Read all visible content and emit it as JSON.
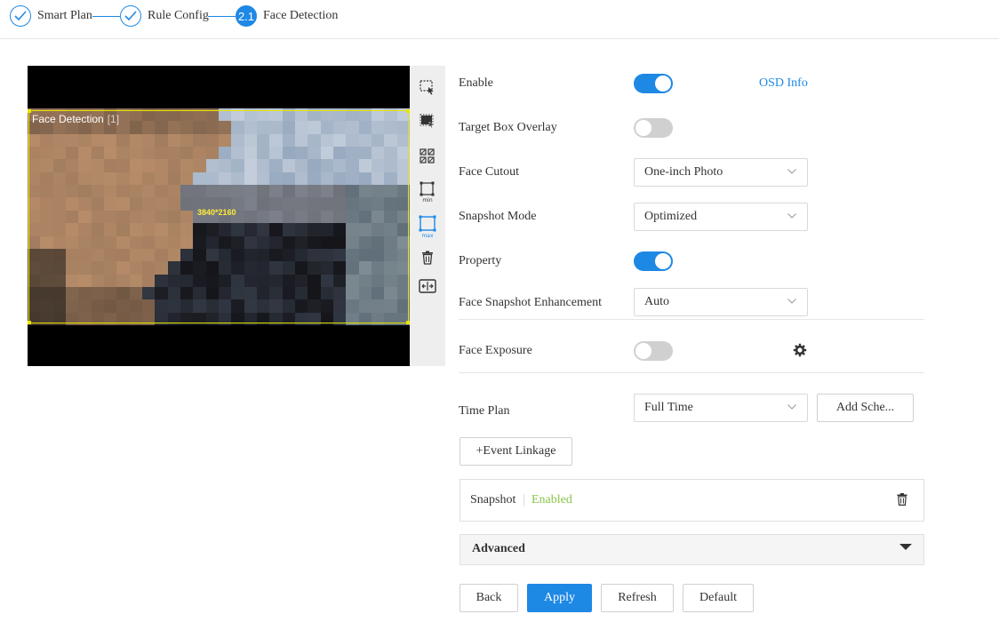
{
  "stepper": {
    "steps": [
      {
        "label": "Smart Plan",
        "state": "done"
      },
      {
        "label": "Rule Config",
        "state": "done"
      },
      {
        "label": "Face Detection",
        "state": "active",
        "number": "2.1"
      }
    ]
  },
  "video": {
    "roi_label": "Face Detection",
    "roi_label_suffix": "[1]",
    "resolution": "3840*2160"
  },
  "toolbar": {
    "tools": [
      "select-region-icon",
      "draw-region-icon",
      "grid-icon",
      "min-size-icon",
      "max-size-icon",
      "delete-icon",
      "expand-icon"
    ],
    "min_text": "min",
    "max_text": "max"
  },
  "form": {
    "enable": {
      "label": "Enable",
      "value": true
    },
    "osd_info": "OSD Info",
    "target_box_overlay": {
      "label": "Target Box Overlay",
      "value": false
    },
    "face_cutout": {
      "label": "Face Cutout",
      "value": "One-inch Photo"
    },
    "snapshot_mode": {
      "label": "Snapshot Mode",
      "value": "Optimized"
    },
    "property": {
      "label": "Property",
      "value": true
    },
    "face_snapshot_enhancement": {
      "label": "Face Snapshot Enhancement",
      "value": "Auto"
    },
    "face_exposure": {
      "label": "Face Exposure",
      "value": false
    },
    "time_plan": {
      "label": "Time Plan",
      "value": "Full Time",
      "add_schedule": "Add Sche..."
    },
    "event_linkage": "+Event Linkage",
    "snapshot": {
      "label": "Snapshot",
      "status": "Enabled"
    },
    "advanced": "Advanced"
  },
  "actions": {
    "back": "Back",
    "apply": "Apply",
    "refresh": "Refresh",
    "default": "Default"
  },
  "colors": {
    "accent": "#1e88e5",
    "enabled_text": "#8bc34a",
    "roi_border": "#e6e600"
  }
}
